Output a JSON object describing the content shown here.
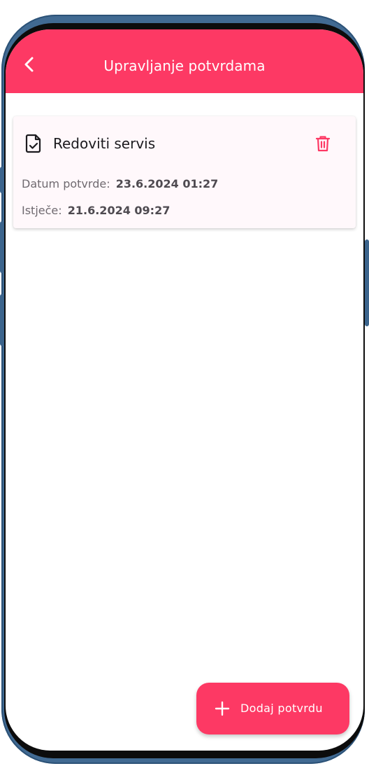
{
  "app_bar": {
    "title": "Upravljanje potvrdama",
    "back_icon": "chevron-left-icon"
  },
  "confirmations": [
    {
      "icon": "document-check-icon",
      "title": "Redoviti servis",
      "delete_icon": "trash-icon",
      "confirmed_label": "Datum potvrde:",
      "confirmed_value": "23.6.2024 01:27",
      "expires_label": "Istječe:",
      "expires_value": "21.6.2024 09:27"
    }
  ],
  "fab": {
    "icon": "plus-icon",
    "label": "Dodaj potvrdu"
  },
  "colors": {
    "accent": "#fd3964",
    "card_background": "#fff8fb",
    "device_frame": "#416a92"
  }
}
